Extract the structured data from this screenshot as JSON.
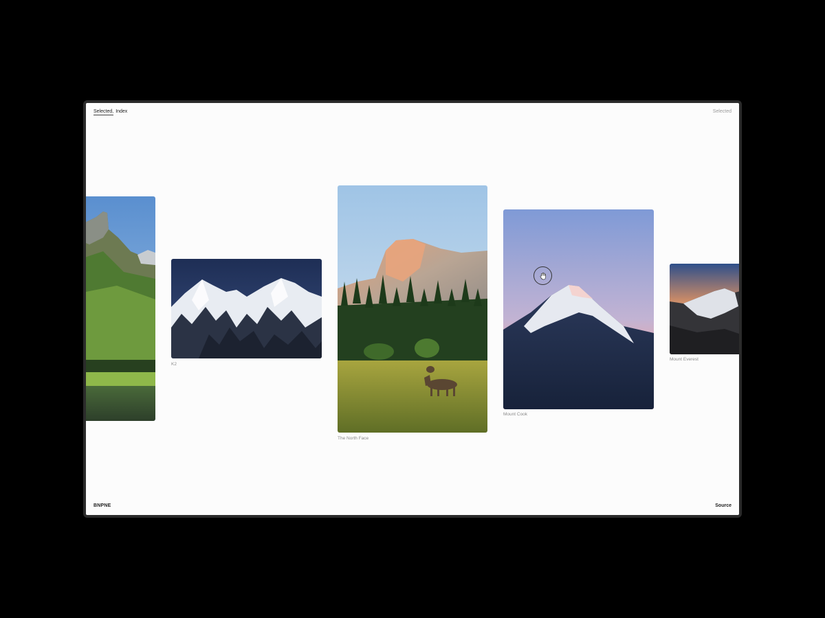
{
  "nav": {
    "selected": "Selected,",
    "index": "Index"
  },
  "header_right": "Selected",
  "brand": "BNPNE",
  "source": "Source",
  "cards": [
    {
      "caption": ""
    },
    {
      "caption": "K2"
    },
    {
      "caption": "The North Face"
    },
    {
      "caption": "Mount Cook"
    },
    {
      "caption": "Mount Everest"
    }
  ],
  "icons": {
    "cursor": "hand-grab-icon"
  },
  "colors": {
    "background": "#000000",
    "screen": "#fcfcfc",
    "frame": "#2b2b2b"
  }
}
